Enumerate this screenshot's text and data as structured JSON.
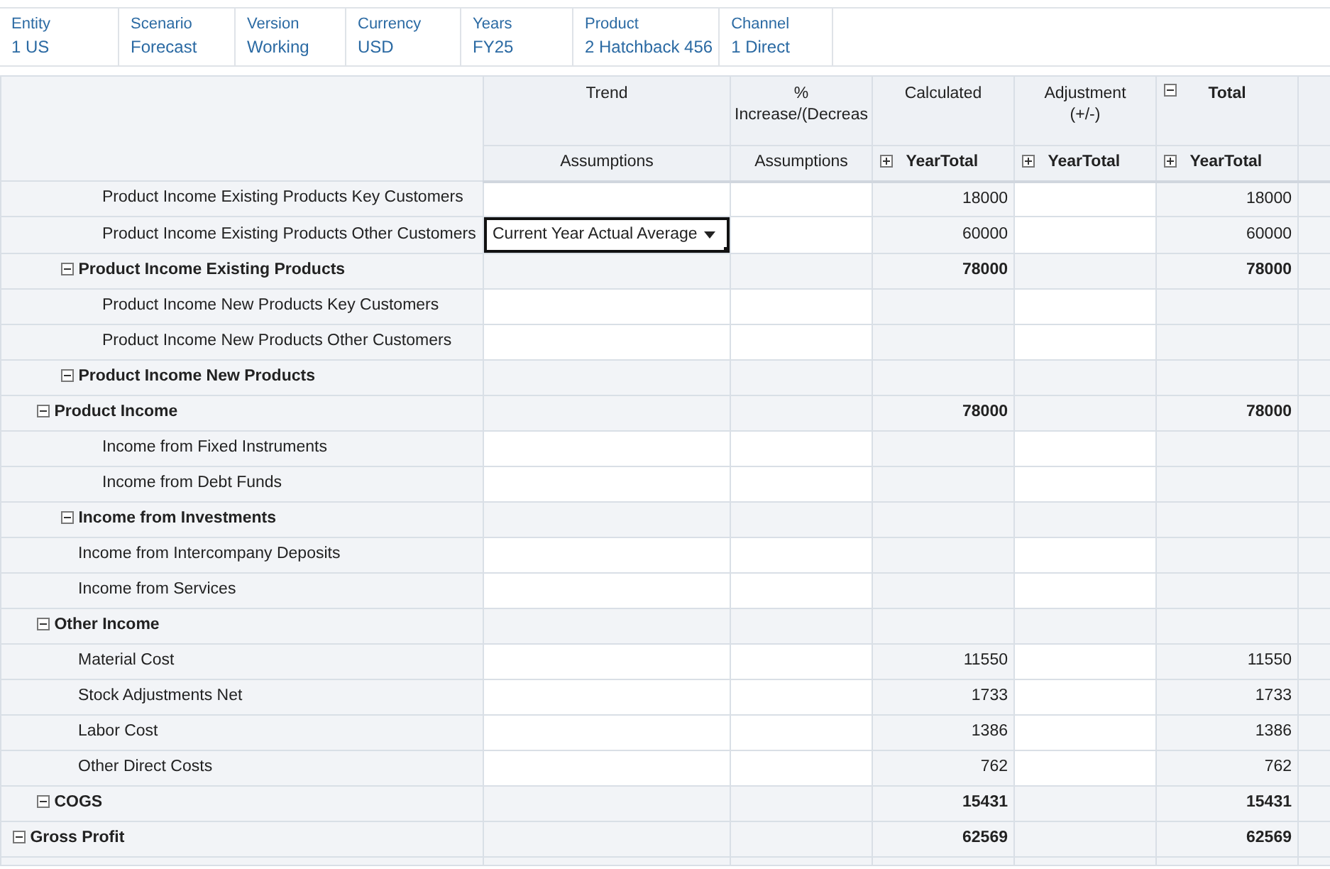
{
  "pov": [
    {
      "label": "Entity",
      "value": "1 US"
    },
    {
      "label": "Scenario",
      "value": "Forecast"
    },
    {
      "label": "Version",
      "value": "Working"
    },
    {
      "label": "Currency",
      "value": "USD"
    },
    {
      "label": "Years",
      "value": "FY25"
    },
    {
      "label": "Product",
      "value": "2 Hatchback 456"
    },
    {
      "label": "Channel",
      "value": "1 Direct"
    }
  ],
  "columns": [
    {
      "kind": "input",
      "header": [
        "Trend"
      ],
      "subheader": "Assumptions"
    },
    {
      "kind": "input",
      "header": [
        "%",
        "Increase/(Decreas"
      ],
      "subheader": "Assumptions"
    },
    {
      "kind": "readonly",
      "header": [
        "Calculated"
      ],
      "subheader": "YearTotal",
      "subheader_expanded": false
    },
    {
      "kind": "input",
      "header": [
        "Adjustment",
        "(+/-)"
      ],
      "subheader": "YearTotal",
      "subheader_expanded": false
    },
    {
      "kind": "readonly",
      "header": [
        "Total"
      ],
      "subheader": "YearTotal",
      "header_expanded": true,
      "subheader_expanded": false
    }
  ],
  "rows": [
    {
      "label": "Gross Profit",
      "expanded": true,
      "calculated": "62569",
      "total": "62569",
      "children": [
        {
          "label": "Product Income",
          "expanded": true,
          "calculated": "78000",
          "total": "78000",
          "children": [
            {
              "label": "Product Income Existing Products",
              "expanded": true,
              "calculated": "78000",
              "total": "78000",
              "children": [
                {
                  "label": "Product Income Existing Products Key Customers",
                  "calculated": "18000",
                  "total": "18000"
                },
                {
                  "label": "Product Income Existing Products Other Customers",
                  "trend": {
                    "value": "Current Year Actual Average",
                    "selected": true
                  },
                  "calculated": "60000",
                  "total": "60000"
                }
              ]
            },
            {
              "label": "Product Income New Products",
              "expanded": true,
              "children": [
                {
                  "label": "Product Income New Products Key Customers"
                },
                {
                  "label": "Product Income New Products Other Customers"
                }
              ]
            }
          ]
        },
        {
          "label": "Other Income",
          "expanded": true,
          "children": [
            {
              "label": "Income from Investments",
              "expanded": true,
              "children": [
                {
                  "label": "Income from Fixed Instruments"
                },
                {
                  "label": "Income from Debt Funds"
                }
              ]
            },
            {
              "label": "Income from Intercompany Deposits"
            },
            {
              "label": "Income from Services"
            }
          ]
        },
        {
          "label": "COGS",
          "expanded": true,
          "calculated": "15431",
          "total": "15431",
          "children": [
            {
              "label": "Material Cost",
              "calculated": "11550",
              "total": "11550"
            },
            {
              "label": "Stock Adjustments Net",
              "calculated": "1733",
              "total": "1733"
            },
            {
              "label": "Labor Cost",
              "calculated": "1386",
              "total": "1386"
            },
            {
              "label": "Other Direct Costs",
              "calculated": "762",
              "total": "762"
            }
          ]
        }
      ]
    }
  ]
}
